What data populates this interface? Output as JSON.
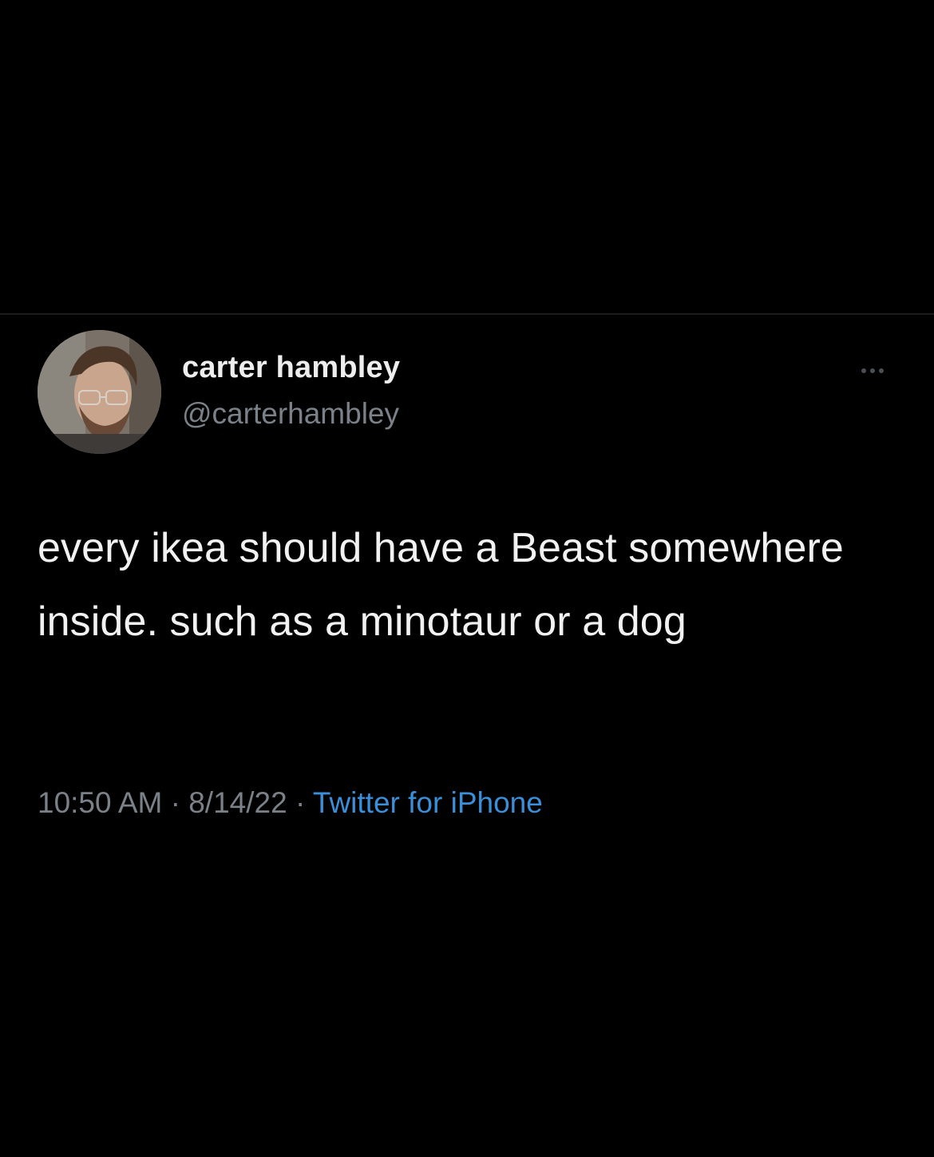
{
  "tweet": {
    "display_name": "carter hambley",
    "handle": "@carterhambley",
    "text": "every ikea should have a Beast somewhere inside. such as a minotaur or a dog",
    "time": "10:50 AM",
    "separator": " · ",
    "date": "8/14/22",
    "source": "Twitter for iPhone"
  },
  "icons": {
    "more": "more-options-icon"
  },
  "colors": {
    "background": "#000000",
    "name": "#ededed",
    "secondary_text": "#7b8188",
    "link": "#3a8fd8"
  }
}
